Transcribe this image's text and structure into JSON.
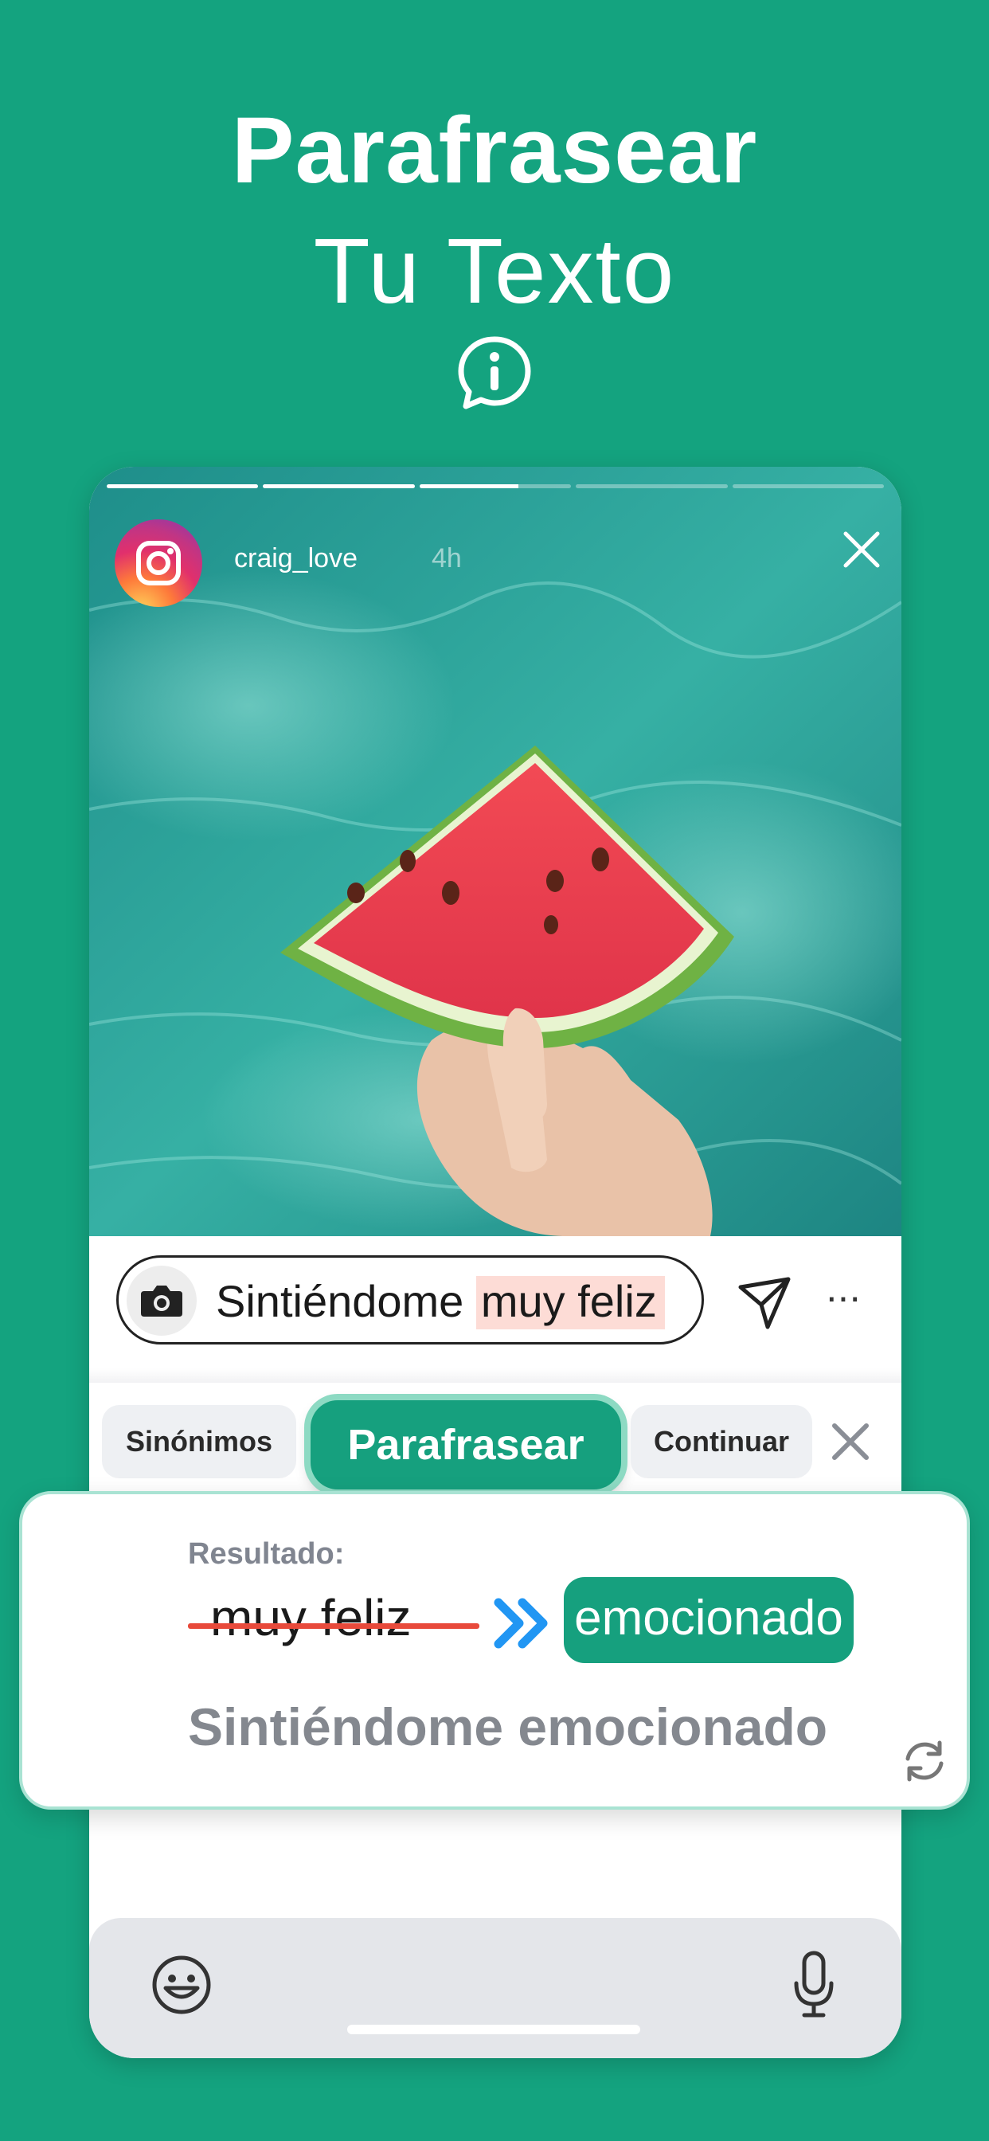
{
  "colors": {
    "background": "#14A37F",
    "accent": "#16A07E",
    "strike": "#E84A3B",
    "highlight": "#FDDCD6",
    "arrows": "#2196F3"
  },
  "header": {
    "title": "Parafrasear",
    "subtitle": "Tu Texto",
    "info_icon": "info-bubble-icon"
  },
  "story": {
    "username": "craig_love",
    "time_ago": "4h",
    "progress": [
      1,
      1,
      0.65,
      0,
      0
    ],
    "app_icon": "instagram-icon",
    "close_icon": "close-icon"
  },
  "reply": {
    "prefix": "Sintiéndome ",
    "highlight": "muy feliz",
    "camera_icon": "camera-icon",
    "send_icon": "send-icon",
    "more_icon": "more-icon",
    "more_label": "···"
  },
  "tools": {
    "synonyms": "Sinónimos",
    "paraphrase": "Parafrasear",
    "continue": "Continuar",
    "close_icon": "close-icon"
  },
  "result": {
    "label": "Resultado:",
    "original": "muy feliz",
    "replacement": "emocionado",
    "sentence": "Sintiéndome emocionado",
    "arrows_icon": "double-chevron-right-icon",
    "refresh_icon": "refresh-icon"
  },
  "keyboard": {
    "emoji_icon": "emoji-icon",
    "mic_icon": "microphone-icon"
  }
}
